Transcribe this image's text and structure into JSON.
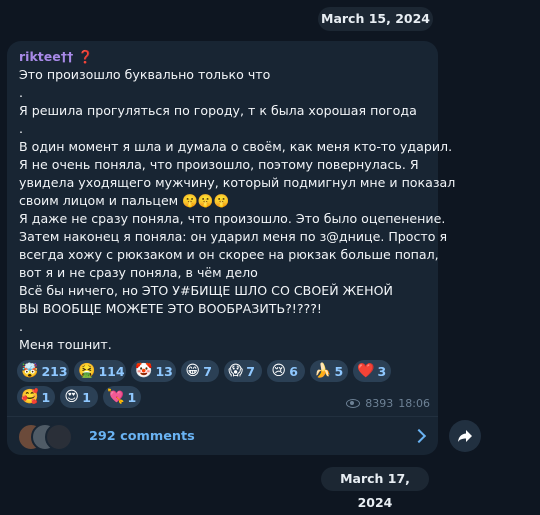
{
  "date_top": "March 15, 2024",
  "date_bottom": "March 17, 2024",
  "post": {
    "author": "riktee†† ❓",
    "lines": [
      "Это произошло буквально только что",
      ".",
      "Я решила прогуляться по городу, т к была хорошая погода",
      ".",
      "В один момент я шла и думала о своём, как меня кто-то ударил.",
      "Я не очень поняла, что произошло, поэтому повернулась. Я",
      "увидела уходящего мужчину, который подмигнул мне и показал",
      "своим лицом и пальцем 🤫🤫🤫",
      "Я даже не сразу поняла, что произошло. Это было оцепенение.",
      "Затем наконец я поняла: он ударил меня по з@днице. Просто я",
      "всегда хожу с рюкзаком и он скорее на рюкзак больше попал,",
      "вот я и не сразу поняла, в чём дело",
      "Всё бы ничего, но ЭТО У#БИЩЕ ШЛО СО СВОЕЙ ЖЕНОЙ",
      "ВЫ ВООБЩЕ МОЖЕТЕ ЭТО ВООБРАЗИТЬ?!???!",
      ".",
      "Меня тошнит."
    ],
    "reactions": [
      {
        "emoji": "🤯",
        "count": "213"
      },
      {
        "emoji": "🤮",
        "count": "114"
      },
      {
        "emoji": "🤡",
        "count": "13"
      },
      {
        "emoji": "😁",
        "count": "7"
      },
      {
        "emoji": "😱",
        "count": "7"
      },
      {
        "emoji": "😢",
        "count": "6"
      },
      {
        "emoji": "🍌",
        "count": "5"
      },
      {
        "emoji": "❤️",
        "count": "3"
      },
      {
        "emoji": "🥰",
        "count": "1"
      },
      {
        "emoji": "😍",
        "count": "1"
      },
      {
        "emoji": "💘",
        "count": "1"
      }
    ],
    "views": "8393",
    "time": "18:06",
    "comments_label": "292 comments"
  }
}
